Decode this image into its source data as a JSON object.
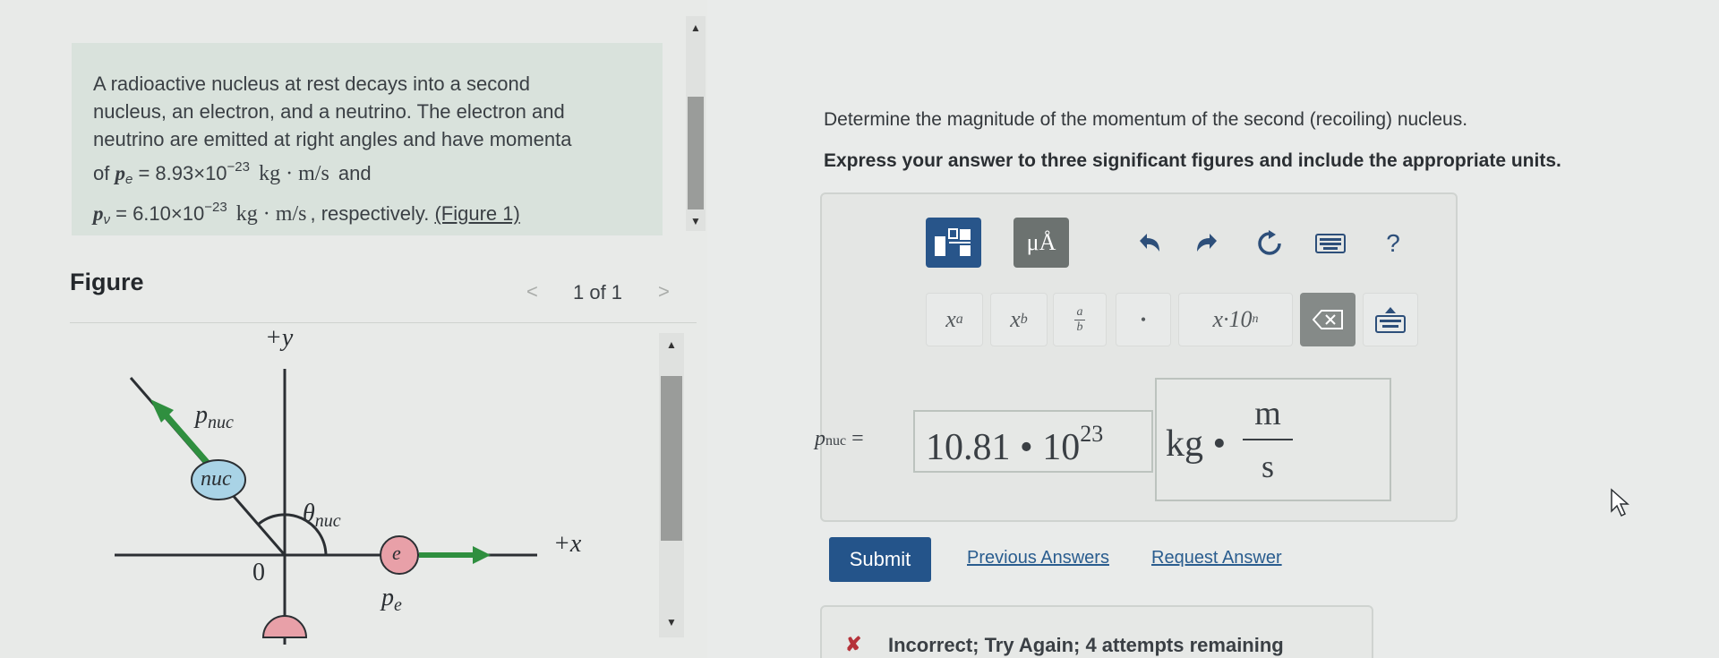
{
  "problem": {
    "line1": "A radioactive nucleus at rest decays into a second",
    "line2": "nucleus, an electron, and a neutrino. The electron and",
    "line3": "neutrino are emitted at right angles and have momenta",
    "of": "of",
    "pe_symbol": "p",
    "pe_sub": "e",
    "pe_value": " = 8.93×10",
    "pe_exp": "−23",
    "unit": "kg · m/s",
    "and": "and",
    "pv_symbol": "p",
    "pv_sub": "ν",
    "pv_value": " = 6.10×10",
    "pv_exp": "−23",
    "respectively": ", respectively.",
    "figure_link": "(Figure 1)"
  },
  "figure": {
    "title": "Figure",
    "counter": "1 of 1",
    "prev": "<",
    "next": ">",
    "labels": {
      "plus_y": "+y",
      "plus_x": "+x",
      "p_nuc": "p",
      "p_nuc_sub": "nuc",
      "nuc": "nuc",
      "theta": "θ",
      "theta_sub": "nuc",
      "e": "e",
      "p_e": "p",
      "p_e_sub": "e",
      "origin": "0"
    }
  },
  "question": {
    "prompt": "Determine the magnitude of the momentum of the second (recoiling) nucleus.",
    "instruction": "Express your answer to three significant figures and include the appropriate units."
  },
  "toolbar": {
    "templates_icon": "templates-icon",
    "units_label": "μÅ",
    "undo_icon": "undo-icon",
    "redo_icon": "redo-icon",
    "reset_icon": "reset-icon",
    "keyboard_icon": "keyboard-icon",
    "help_label": "?",
    "row2": {
      "superscript": "x",
      "superscript_exp": "a",
      "subscript": "x",
      "subscript_sub": "b",
      "fraction_num": "a",
      "fraction_den": "b",
      "dot": "•",
      "sci": "x·10",
      "sci_exp": "n"
    }
  },
  "answer": {
    "variable": "p",
    "variable_sub": "nuc",
    "equals": " =",
    "value": "10.81 • 10",
    "exponent": "23",
    "unit_kg": "kg •",
    "unit_num": "m",
    "unit_den": "s"
  },
  "actions": {
    "submit": "Submit",
    "previous_answers": "Previous Answers",
    "request_answer": "Request Answer"
  },
  "feedback": {
    "status": "Incorrect; Try Again; 4 attempts remaining",
    "icon": "x-icon",
    "color": "#b5323a"
  },
  "colors": {
    "accent": "#24548a",
    "arrow_green": "#2f8f3f",
    "electron_fill": "#e8a0a8",
    "nucleus_fill": "#a9d3e6"
  }
}
